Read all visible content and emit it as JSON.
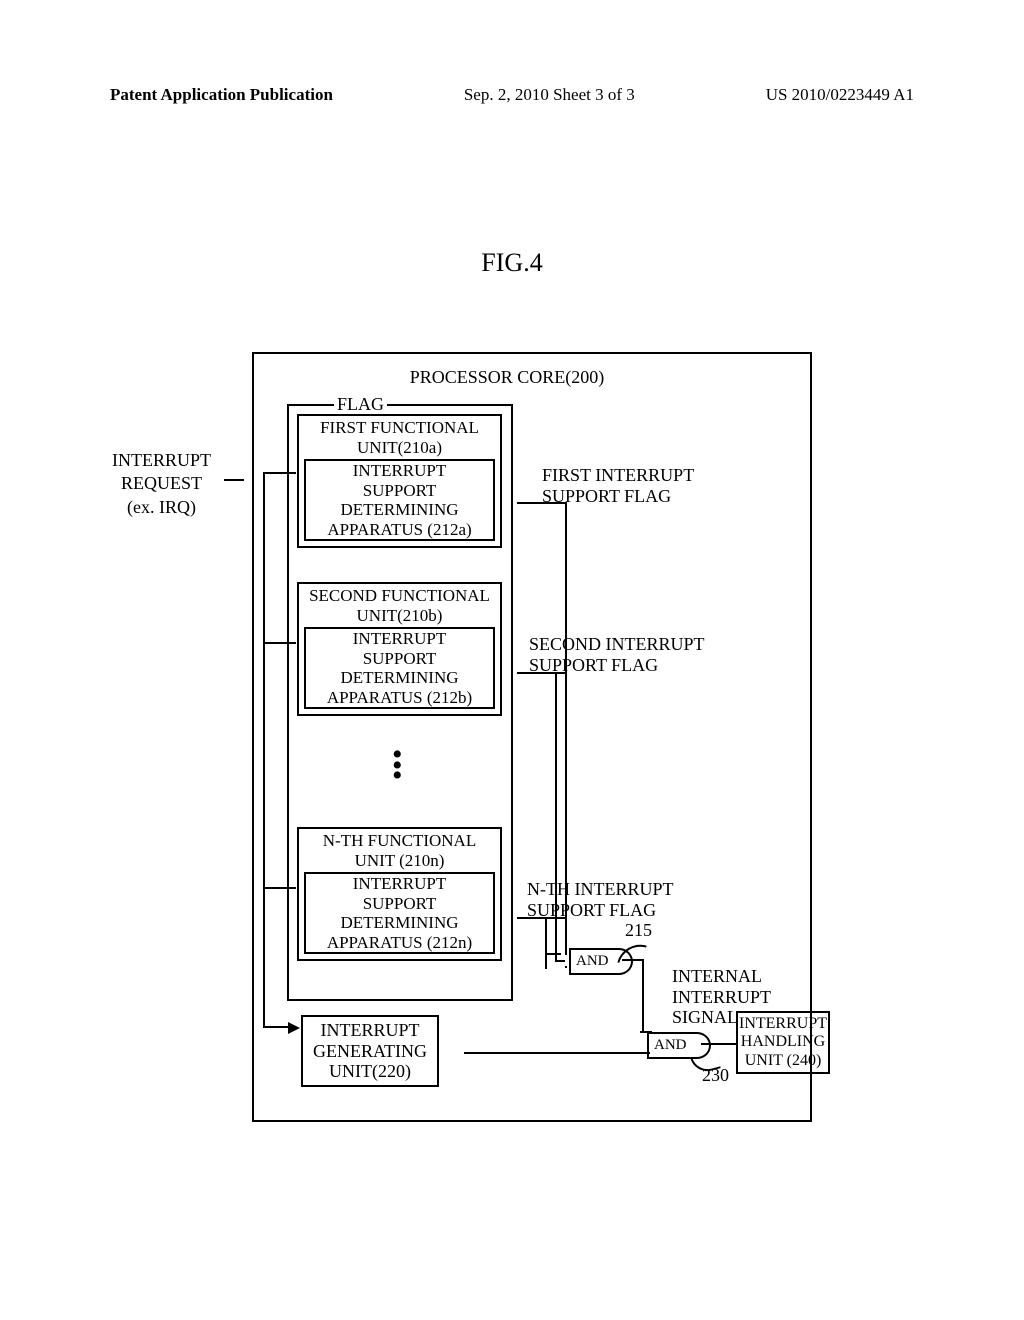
{
  "header": {
    "left": "Patent Application Publication",
    "center": "Sep. 2, 2010  Sheet 3 of 3",
    "right": "US 2010/0223449 A1"
  },
  "figure_title": "FIG.4",
  "diagram": {
    "processor_core": "PROCESSOR CORE(200)",
    "irq_label": "INTERRUPT\nREQUEST\n(ex. IRQ)",
    "flag_label": "FLAG",
    "func_units": [
      {
        "title": "FIRST FUNCTIONAL\nUNIT(210a)",
        "apparatus": "INTERRUPT\nSUPPORT\nDETERMINING\nAPPARATUS (212a)",
        "flag": "FIRST INTERRUPT\nSUPPORT FLAG"
      },
      {
        "title": "SECOND FUNCTIONAL\nUNIT(210b)",
        "apparatus": "INTERRUPT\nSUPPORT\nDETERMINING\nAPPARATUS (212b)",
        "flag": "SECOND INTERRUPT\nSUPPORT FLAG"
      },
      {
        "title": "N-TH FUNCTIONAL\nUNIT (210n)",
        "apparatus": "INTERRUPT\nSUPPORT\nDETERMINING\nAPPARATUS (212n)",
        "flag": "N-TH INTERRUPT\nSUPPORT FLAG"
      }
    ],
    "and1": "AND",
    "and2": "AND",
    "ref215": "215",
    "internal_sig": "INTERNAL\nINTERRUPT\nSIGNAL",
    "igen": "INTERRUPT\nGENERATING\nUNIT(220)",
    "ref230": "230",
    "ihu": "INTERRUPT\nHANDLING\nUNIT (240)"
  }
}
